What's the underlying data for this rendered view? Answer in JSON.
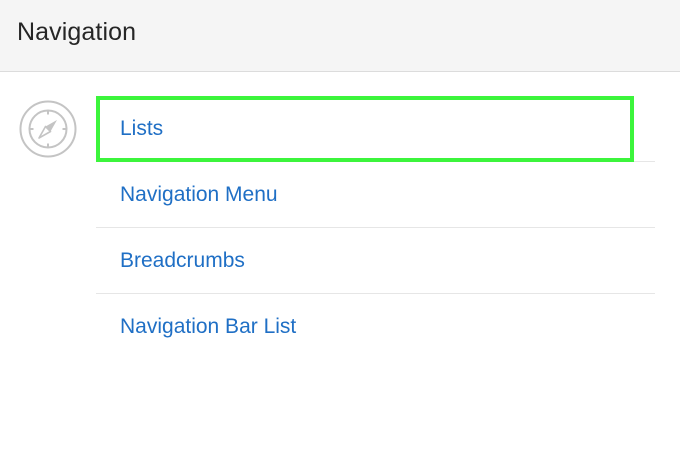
{
  "panel": {
    "title": "Navigation",
    "icon": "compass-icon"
  },
  "nav": {
    "items": [
      {
        "label": "Lists",
        "focused": true
      },
      {
        "label": "Navigation Menu",
        "focused": false
      },
      {
        "label": "Breadcrumbs",
        "focused": false
      },
      {
        "label": "Navigation Bar List",
        "focused": false
      }
    ]
  },
  "colors": {
    "link": "#1f6fc5",
    "focus_outline": "#3cf53c",
    "header_bg": "#f5f5f5"
  }
}
